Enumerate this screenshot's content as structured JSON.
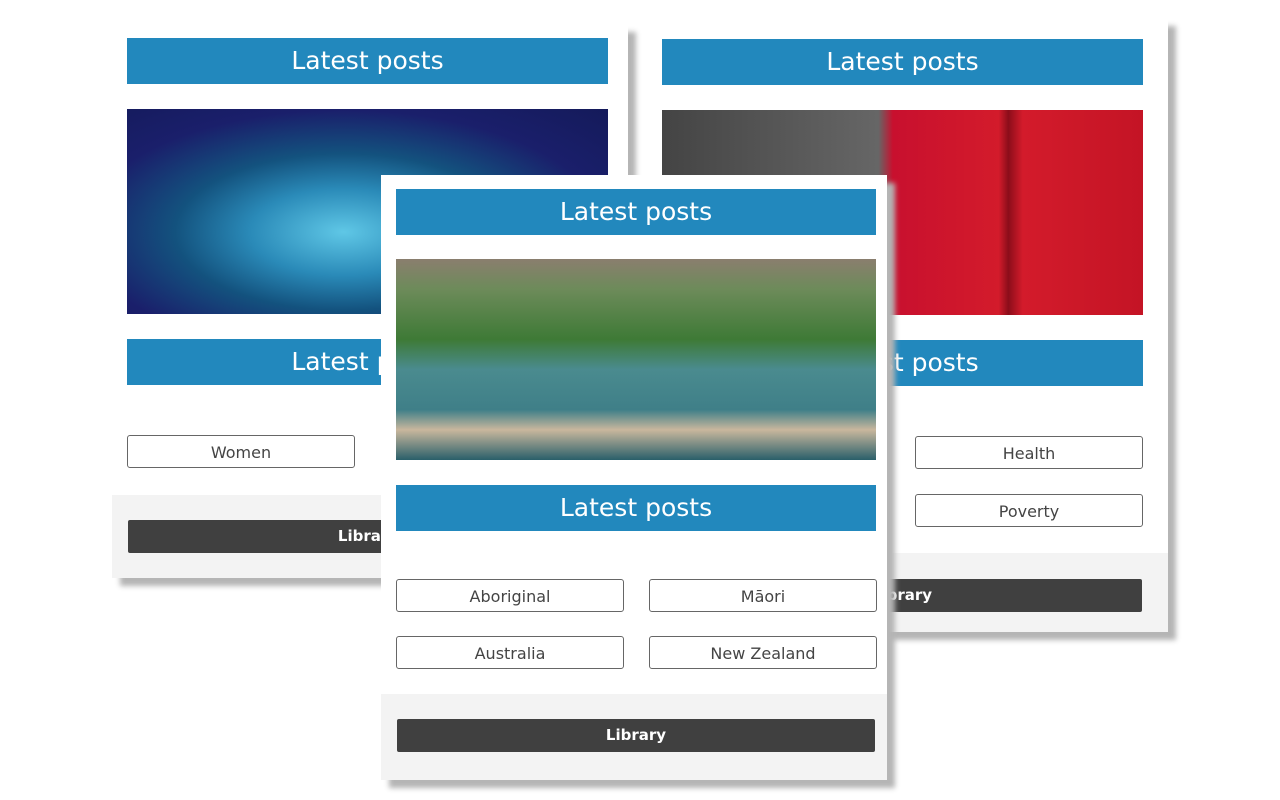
{
  "colors": {
    "header": "#2288bd",
    "library_button": "#404040",
    "footer": "#f3f3f3"
  },
  "cards": [
    {
      "header": "Latest posts",
      "image": "lotus-temple-photo",
      "header2": "Latest posts",
      "tags": [
        "Women"
      ],
      "library": "Library"
    },
    {
      "header": "Latest posts",
      "image": "london-telephone-boxes-photo",
      "header2": "Latest posts",
      "tags": [
        "Health",
        "Poverty"
      ],
      "library": "Library"
    },
    {
      "header": "Latest posts",
      "image": "sydney-opera-house-aerial-photo",
      "header2": "Latest posts",
      "tags": [
        "Aboriginal",
        "Māori",
        "Australia",
        "New Zealand"
      ],
      "library": "Library"
    }
  ]
}
